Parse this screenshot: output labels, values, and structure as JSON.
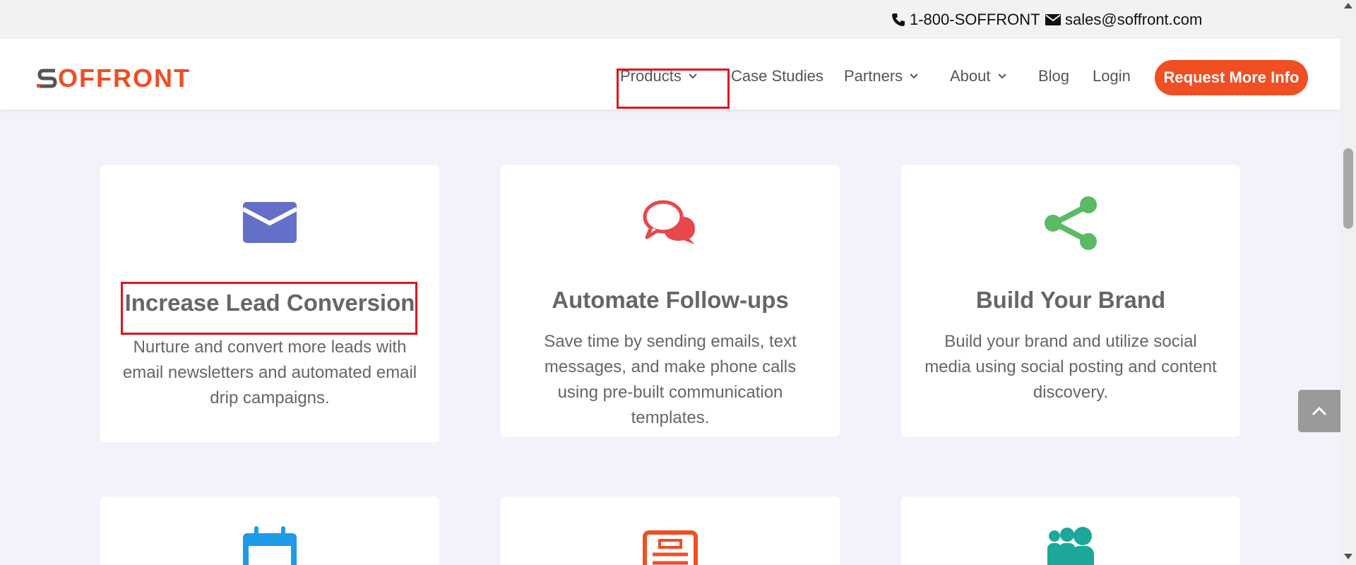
{
  "topbar": {
    "phone": "1-800-SOFFRONT",
    "email": "sales@soffront.com"
  },
  "header": {
    "logo_text": "SOFFRONT",
    "nav": {
      "products": "Products",
      "case_studies": "Case Studies",
      "partners": "Partners",
      "about": "About",
      "blog": "Blog",
      "login": "Login"
    },
    "cta_label": "Request More Info"
  },
  "features": [
    {
      "title": "Increase Lead Conversion",
      "description": "Nurture and convert more leads with email newsletters and automated email drip campaigns.",
      "icon": "envelope-icon",
      "icon_color": "#6470c8"
    },
    {
      "title": "Automate Follow-ups",
      "description": "Save time by sending emails, text messages, and make phone calls using pre-built communication templates.",
      "icon": "chat-bubbles-icon",
      "icon_color": "#e8474c"
    },
    {
      "title": "Build Your Brand",
      "description": "Build your brand and utilize social media using social posting and content discovery.",
      "icon": "share-icon",
      "icon_color": "#5cba65"
    },
    {
      "icon": "calendar-icon",
      "icon_color": "#1e9be8"
    },
    {
      "icon": "newspaper-icon",
      "icon_color": "#f04e23"
    },
    {
      "icon": "users-icon",
      "icon_color": "#1ba89a"
    }
  ],
  "colors": {
    "brand": "#f04e23",
    "highlight": "#e0141e",
    "page_background": "#f2f3fa"
  }
}
